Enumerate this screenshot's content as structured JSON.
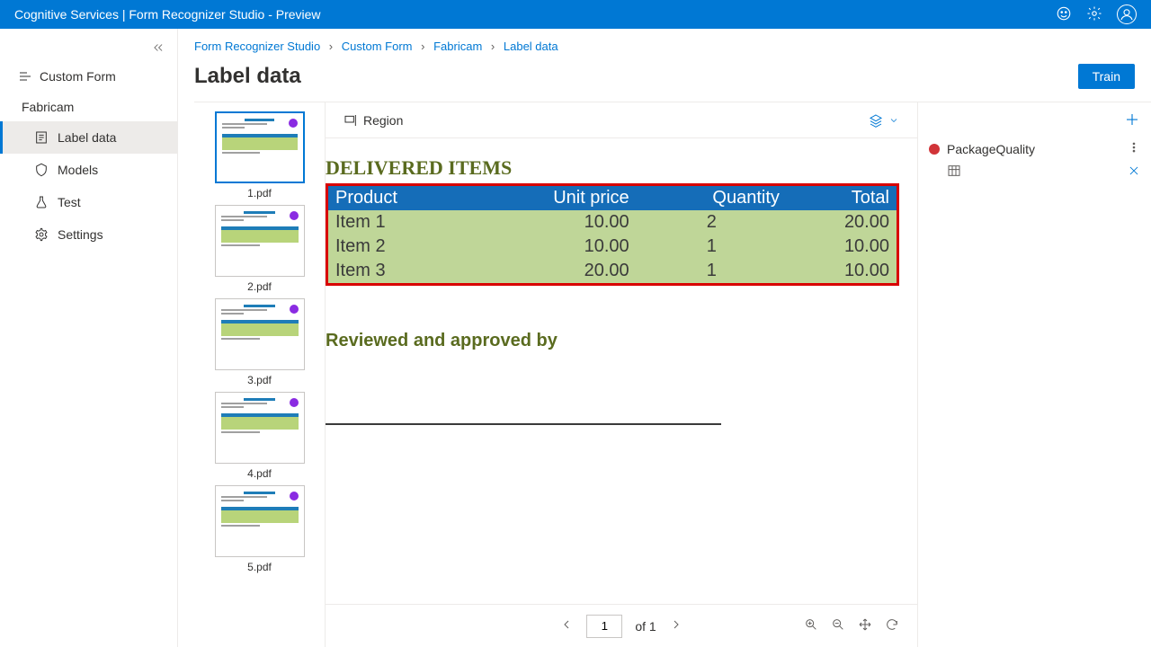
{
  "topbar": {
    "title": "Cognitive Services | Form Recognizer Studio - Preview"
  },
  "sidebar": {
    "header": "Custom Form",
    "project": "Fabricam",
    "items": [
      {
        "label": "Label data"
      },
      {
        "label": "Models"
      },
      {
        "label": "Test"
      },
      {
        "label": "Settings"
      }
    ]
  },
  "breadcrumb": {
    "a": "Form Recognizer Studio",
    "b": "Custom Form",
    "c": "Fabricam",
    "d": "Label data"
  },
  "page": {
    "title": "Label data",
    "train": "Train"
  },
  "toolbar": {
    "region": "Region"
  },
  "thumbnails": [
    {
      "name": "1.pdf"
    },
    {
      "name": "2.pdf"
    },
    {
      "name": "3.pdf"
    },
    {
      "name": "4.pdf"
    },
    {
      "name": "5.pdf"
    }
  ],
  "doc": {
    "section_title": "DELIVERED ITEMS",
    "headers": {
      "product": "Product",
      "unit_price": "Unit price",
      "quantity": "Quantity",
      "total": "Total"
    },
    "rows": [
      {
        "product": "Item 1",
        "unit_price": "10.00",
        "quantity": "2",
        "total": "20.00"
      },
      {
        "product": "Item 2",
        "unit_price": "10.00",
        "quantity": "1",
        "total": "10.00"
      },
      {
        "product": "Item 3",
        "unit_price": "20.00",
        "quantity": "1",
        "total": "10.00"
      }
    ],
    "reviewed": "Reviewed and approved by"
  },
  "pager": {
    "page": "1",
    "of": "of 1"
  },
  "labels": {
    "items": [
      {
        "name": "PackageQuality",
        "color": "#d13438"
      }
    ]
  }
}
